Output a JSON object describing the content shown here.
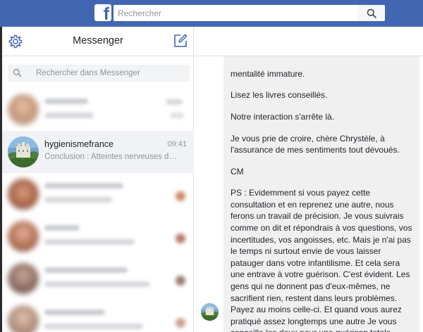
{
  "topbar": {
    "logo": "f",
    "search_placeholder": "Rechercher"
  },
  "sidebar": {
    "title": "Messenger",
    "search_placeholder": "Rechercher dans Messenger",
    "conversations": [
      {
        "name": "",
        "snippet": "",
        "time": "",
        "blurred": true
      },
      {
        "name": "hygienismefrance",
        "snippet": "Conclusion : Atteintes nerveuses du...",
        "time": "09:41",
        "blurred": false,
        "active": true
      },
      {
        "name": "",
        "snippet": "",
        "time": "",
        "blurred": true
      },
      {
        "name": "",
        "snippet": "",
        "time": "",
        "blurred": true
      },
      {
        "name": "",
        "snippet": "",
        "time": "",
        "blurred": true
      },
      {
        "name": "",
        "snippet": "",
        "time": "",
        "blurred": true
      }
    ]
  },
  "chat": {
    "message_paragraphs": [
      "mentalité immature.",
      "Lisez les livres conseillés.",
      "Notre interaction s'arrête là.",
      "Je vous prie de croire, chère Chrystèle, à l'assurance de mes sentiments tout dévoués.",
      "CM",
      "PS : Evidemment si vous payez cette consultation et en reprenez une autre, nous ferons un travail de précision. Je vous suivrais comme on dit et répondrais à vos questions, vos incertitudes, vos angoisses, etc. Mais je n'ai pas le temps ni surtout envie de vous laisser patauger dans votre infantilisme. Et cela sera une entrave à votre guérison. C'est évident. Les gens qui ne donnent pas d'eux-mêmes, ne sacrifient rien, restent dans leurs problèmes. Payez au moins celle-ci. Et quand vous aurez pratiqué assez longtemps une autre Je vous conseille les deux pour une guérison totale."
    ]
  },
  "colors": {
    "brand": "#4267b2",
    "messenger_blue": "#0084ff",
    "bubble_bg": "#f1f0f0",
    "active_row": "#f0f2f5"
  },
  "icons": {
    "topbar": [
      "facebook-logo",
      "search-icon"
    ],
    "sidebar": [
      "gear-icon",
      "compose-icon",
      "search-icon"
    ]
  }
}
